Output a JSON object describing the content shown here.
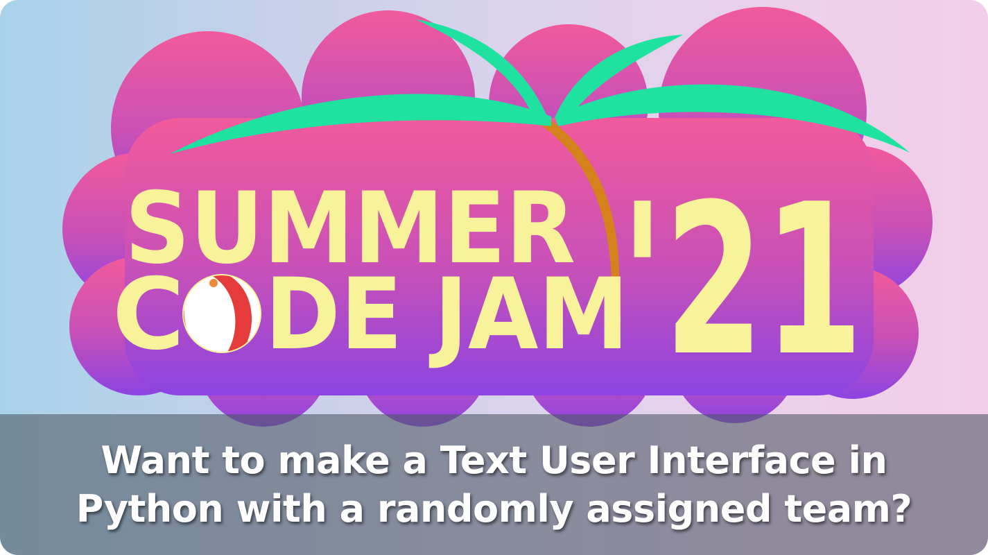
{
  "logo": {
    "line1": "SUMMER",
    "line2_prefix": "C",
    "line2_suffix": "DE JAM",
    "year": "'21",
    "colors": {
      "cloud_top": "#ef5aa0",
      "cloud_bottom": "#8f43e0",
      "text": "#f8f39a",
      "leaf": "#1fe2a0",
      "trunk": "#d5821d",
      "ball_red": "#e63b3b",
      "ball_white": "#ffffff",
      "ball_cap": "#f08a3a"
    }
  },
  "caption": {
    "line1": "Want to make a Text User Interface in",
    "line2": "Python with a randomly assigned team?"
  }
}
